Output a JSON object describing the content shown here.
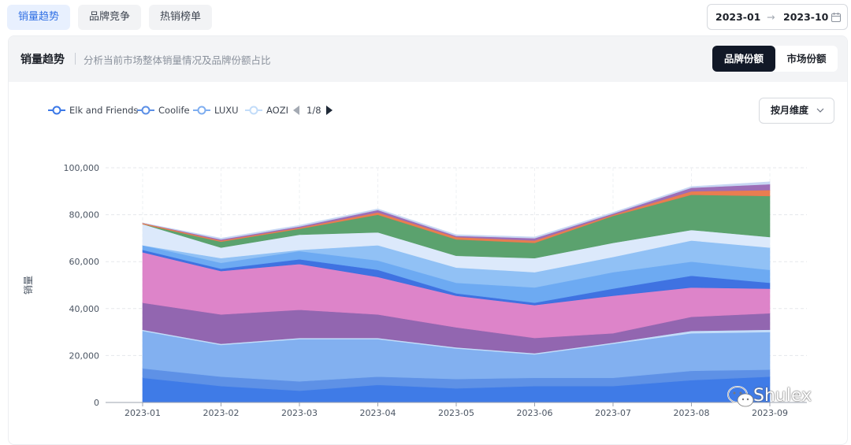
{
  "tabs": [
    {
      "label": "销量趋势",
      "active": true
    },
    {
      "label": "品牌竞争",
      "active": false
    },
    {
      "label": "热销榜单",
      "active": false
    }
  ],
  "date_range": {
    "start": "2023-01",
    "arrow": "→",
    "end": "2023-10"
  },
  "panel": {
    "title": "销量趋势",
    "subtitle": "分析当前市场整体销量情况及品牌份额占比",
    "segment": {
      "options": [
        "品牌份额",
        "市场份额"
      ],
      "selected": "品牌份额"
    }
  },
  "dimension_select": {
    "value": "按月维度"
  },
  "legend_pager": {
    "text": "1/8"
  },
  "watermark": {
    "text": "Shulex"
  },
  "chart_data": {
    "type": "area",
    "stacked": true,
    "categories": [
      "2023-01",
      "2023-02",
      "2023-03",
      "2023-04",
      "2023-05",
      "2023-06",
      "2023-07",
      "2023-08",
      "2023-09"
    ],
    "ylabel": "销量",
    "yticks": [
      "0",
      "20,000",
      "40,000",
      "60,000",
      "80,000",
      "100,000"
    ],
    "ylim": [
      0,
      100000
    ],
    "grid": true,
    "legend_position": "top-left",
    "series": [
      {
        "name": "Elk and Friends",
        "color": "#3b78e7",
        "values": [
          10500,
          7000,
          5000,
          7500,
          6000,
          7000,
          7000,
          9500,
          11000
        ]
      },
      {
        "name": "Coolife",
        "color": "#5b8fe6",
        "values": [
          4000,
          4000,
          4000,
          3500,
          4000,
          3500,
          3500,
          4000,
          3000
        ]
      },
      {
        "name": "LUXU",
        "color": "#7faef0",
        "values": [
          16000,
          13500,
          18000,
          16000,
          13000,
          10000,
          14500,
          16000,
          16000
        ]
      },
      {
        "name": "AOZI",
        "color": "#c2dcf9",
        "values": [
          500,
          500,
          500,
          500,
          500,
          500,
          500,
          1000,
          1000
        ]
      },
      {
        "color": "#9063ae",
        "values": [
          11500,
          12500,
          12000,
          10000,
          8500,
          6500,
          4000,
          6000,
          7000
        ]
      },
      {
        "color": "#dc82c8",
        "values": [
          21500,
          18500,
          19500,
          16000,
          13500,
          14000,
          16000,
          12500,
          10500
        ]
      },
      {
        "color": "#3b6fe0",
        "values": [
          1000,
          1000,
          2000,
          3000,
          1000,
          1000,
          3000,
          5000,
          2500
        ]
      },
      {
        "color": "#6aa8f2",
        "values": [
          2000,
          2500,
          3500,
          4000,
          4500,
          6500,
          7000,
          6000,
          5500
        ]
      },
      {
        "color": "#8fc0f5",
        "values": [
          0,
          2000,
          500,
          6500,
          6500,
          6500,
          6500,
          9000,
          9500
        ]
      },
      {
        "color": "#dbe9fb",
        "values": [
          9000,
          4500,
          6500,
          5500,
          5000,
          6000,
          6000,
          4500,
          4500
        ]
      },
      {
        "color": "#58a06b",
        "values": [
          0,
          2500,
          2500,
          7500,
          7000,
          6500,
          11500,
          15000,
          17500
        ]
      },
      {
        "color": "#e97a4e",
        "values": [
          500,
          500,
          500,
          1000,
          1000,
          1000,
          500,
          1500,
          2500
        ]
      },
      {
        "color": "#9b6bb6",
        "values": [
          0,
          500,
          500,
          1000,
          500,
          1000,
          500,
          1500,
          2500
        ]
      },
      {
        "color": "#c6d6f3",
        "values": [
          0,
          500,
          500,
          500,
          500,
          500,
          500,
          500,
          1000
        ]
      }
    ]
  }
}
